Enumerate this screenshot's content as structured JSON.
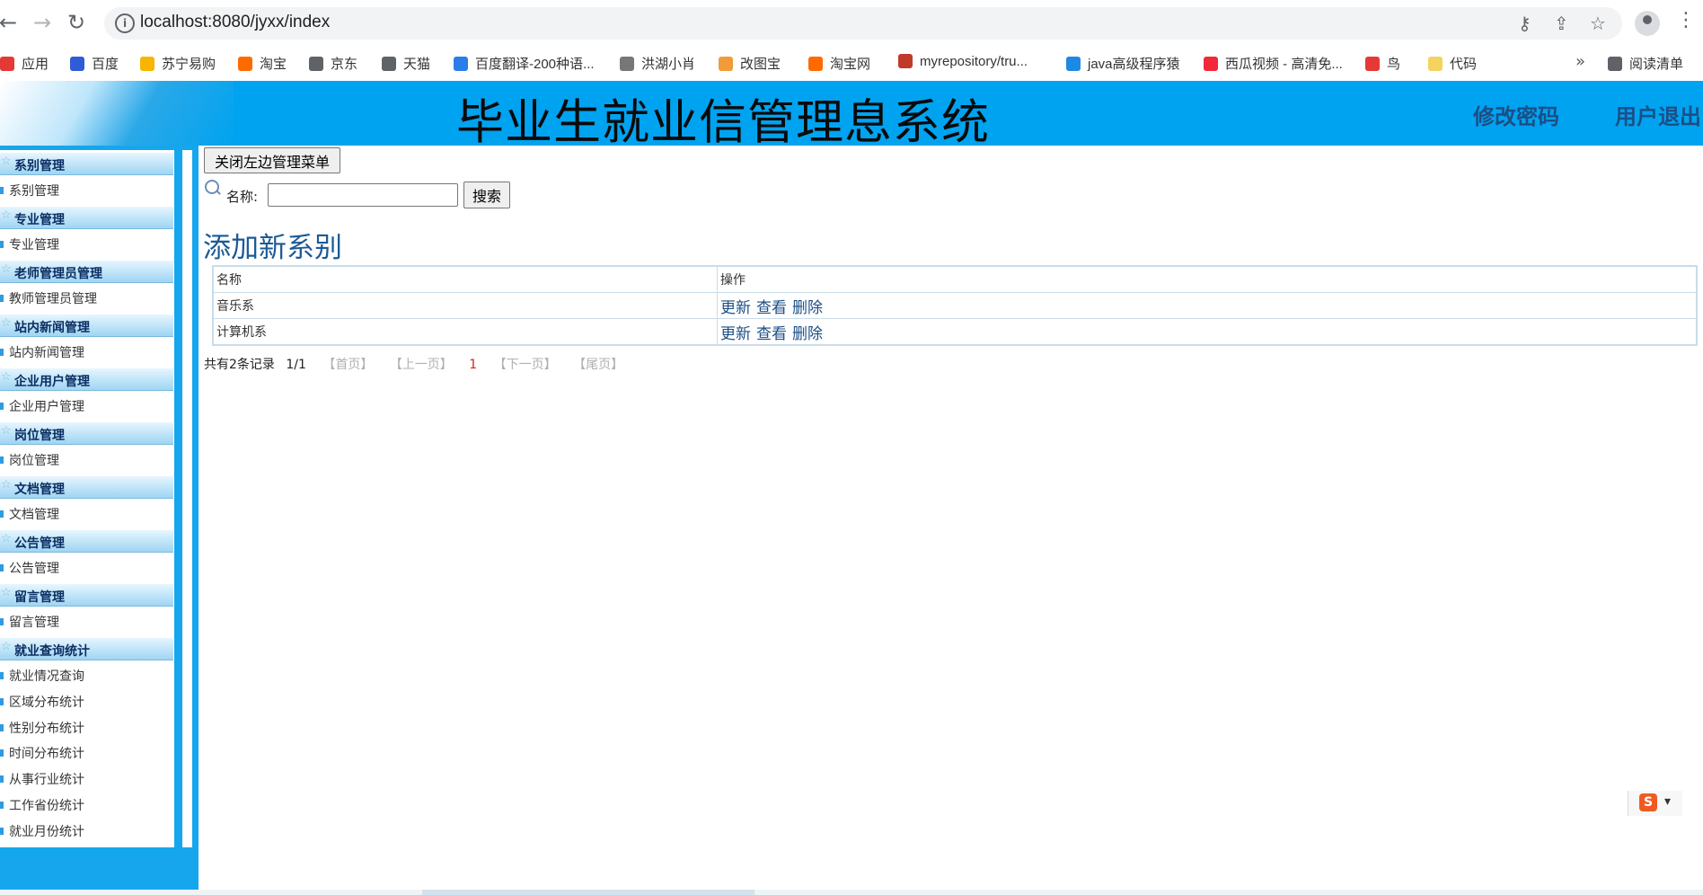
{
  "browser": {
    "url": "localhost:8080/jyxx/index",
    "bookmarks": [
      {
        "label": "应用",
        "color": "#e53935"
      },
      {
        "label": "百度",
        "color": "#2f5bd7"
      },
      {
        "label": "苏宁易购",
        "color": "#f7b500"
      },
      {
        "label": "淘宝",
        "color": "#ff6a00"
      },
      {
        "label": "京东",
        "color": "#5f6368"
      },
      {
        "label": "天猫",
        "color": "#5f6368"
      },
      {
        "label": "百度翻译-200种语...",
        "color": "#2b7de9"
      },
      {
        "label": "洪湖小肖",
        "color": "#777777"
      },
      {
        "label": "改图宝",
        "color": "#f29b38"
      },
      {
        "label": "淘宝网",
        "color": "#ff6a00"
      },
      {
        "label": "myrepository/tru...",
        "color": "#c0392b"
      },
      {
        "label": "java高级程序猿",
        "color": "#1e88e5"
      },
      {
        "label": "西瓜视频 - 高清免...",
        "color": "#f2293a"
      },
      {
        "label": "鸟",
        "color": "#e53935"
      },
      {
        "label": "代码",
        "color": "#f4d35e"
      },
      {
        "label": "阅读清单",
        "color": "#5f6368"
      }
    ],
    "bookmarks_more": "»"
  },
  "header": {
    "title": "毕业生就业信管理息系统",
    "change_password": "修改密码",
    "logout": "用户退出"
  },
  "sidebar": {
    "groups": [
      {
        "title": "系别管理",
        "items": [
          "系别管理"
        ]
      },
      {
        "title": "专业管理",
        "items": [
          "专业管理"
        ]
      },
      {
        "title": "老师管理员管理",
        "items": [
          "教师管理员管理"
        ]
      },
      {
        "title": "站内新闻管理",
        "items": [
          "站内新闻管理"
        ]
      },
      {
        "title": "企业用户管理",
        "items": [
          "企业用户管理"
        ]
      },
      {
        "title": "岗位管理",
        "items": [
          "岗位管理"
        ]
      },
      {
        "title": "文档管理",
        "items": [
          "文档管理"
        ]
      },
      {
        "title": "公告管理",
        "items": [
          "公告管理"
        ]
      },
      {
        "title": "留言管理",
        "items": [
          "留言管理"
        ]
      },
      {
        "title": "就业查询统计",
        "items": [
          "就业情况查询",
          "区域分布统计",
          "性别分布统计",
          "时间分布统计",
          "从事行业统计",
          "工作省份统计",
          "就业月份统计"
        ]
      }
    ]
  },
  "main": {
    "close_menu_button": "关闭左边管理菜单",
    "search_label": "名称:",
    "search_value": "",
    "search_button": "搜索",
    "add_link": "添加新系别",
    "table": {
      "headers": [
        "名称",
        "操作"
      ],
      "rows": [
        {
          "name": "音乐系",
          "ops": [
            "更新",
            "查看",
            "删除"
          ]
        },
        {
          "name": "计算机系",
          "ops": [
            "更新",
            "查看",
            "删除"
          ]
        }
      ]
    },
    "pager": {
      "summary": "共有2条记录",
      "page": "1/1",
      "first": "【首页】",
      "prev": "【上一页】",
      "current": "1",
      "next": "【下一页】",
      "last": "【尾页】"
    }
  },
  "ime": {
    "label": "S"
  }
}
